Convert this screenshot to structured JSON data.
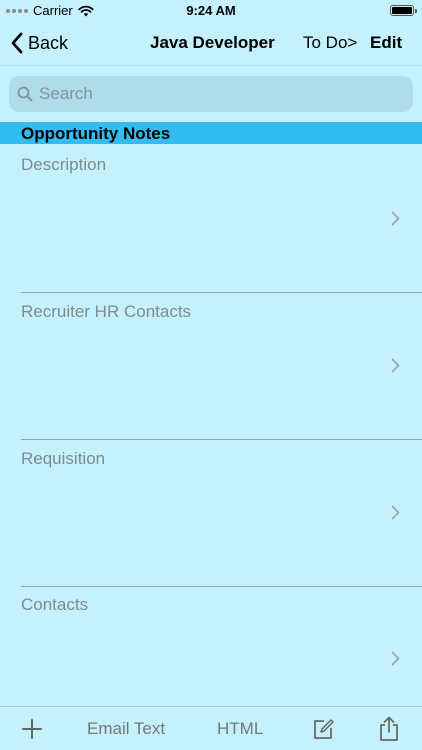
{
  "status_bar": {
    "carrier": "Carrier",
    "time": "9:24 AM",
    "icons": [
      "signal-dots-icon",
      "wifi-icon",
      "battery-icon"
    ]
  },
  "nav": {
    "back_label": "Back",
    "title": "Java Developer",
    "todo_label": "To Do>",
    "edit_label": "Edit"
  },
  "search": {
    "placeholder": "Search",
    "value": ""
  },
  "section": {
    "header": "Opportunity Notes",
    "rows": [
      {
        "label": "Description"
      },
      {
        "label": "Recruiter HR Contacts"
      },
      {
        "label": "Requisition"
      },
      {
        "label": "Contacts"
      }
    ]
  },
  "toolbar": {
    "add_icon": "plus-icon",
    "email_label": "Email Text",
    "html_label": "HTML",
    "compose_icon": "compose-icon",
    "share_icon": "share-icon"
  },
  "colors": {
    "background": "#c5f1fc",
    "section_header": "#33bcef",
    "search_field": "#b0dcea"
  }
}
